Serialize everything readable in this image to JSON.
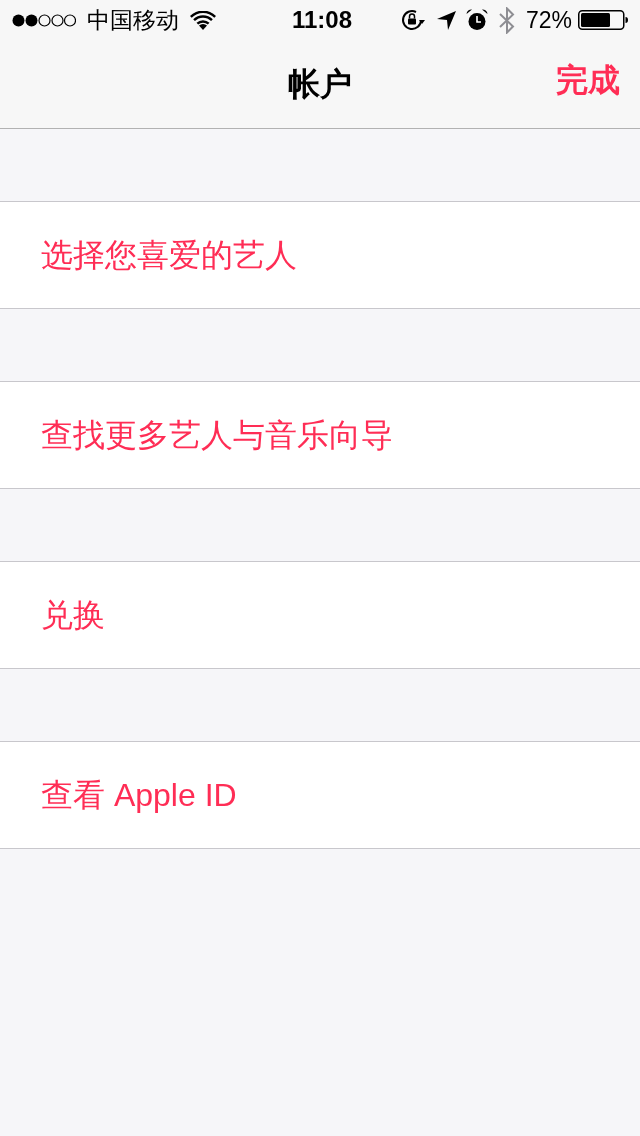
{
  "status_bar": {
    "carrier": "中国移动",
    "time": "11:08",
    "battery": "72%"
  },
  "nav_bar": {
    "title": "帐户",
    "done_button": "完成"
  },
  "rows": [
    {
      "label": "选择您喜爱的艺人"
    },
    {
      "label": "查找更多艺人与音乐向导"
    },
    {
      "label": "兑换"
    },
    {
      "label": "查看 Apple ID"
    }
  ]
}
